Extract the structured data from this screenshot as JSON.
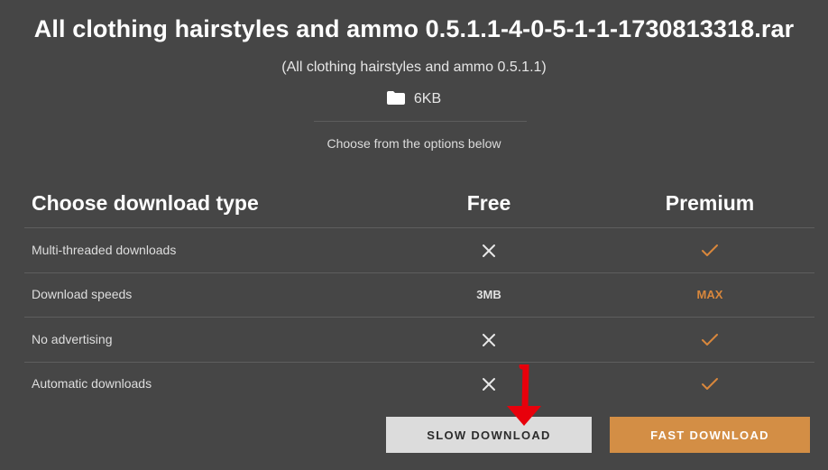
{
  "file": {
    "title": "All clothing hairstyles and ammo 0.5.1.1-4-0-5-1-1-1730813318.rar",
    "subtitle": "(All clothing hairstyles and ammo 0.5.1.1)",
    "size": "6KB",
    "size_icon": "folder-icon"
  },
  "note": "Choose from the options below",
  "table": {
    "headers": {
      "type": "Choose download type",
      "free": "Free",
      "premium": "Premium"
    },
    "rows": [
      {
        "label": "Multi-threaded downloads",
        "free_icon": "cross-icon",
        "premium_icon": "check-icon"
      },
      {
        "label": "Download speeds",
        "free": "3MB",
        "premium": "MAX"
      },
      {
        "label": "No advertising",
        "free_icon": "cross-icon",
        "premium_icon": "check-icon"
      },
      {
        "label": "Automatic downloads",
        "free_icon": "cross-icon",
        "premium_icon": "check-icon"
      }
    ]
  },
  "buttons": {
    "slow": "SLOW DOWNLOAD",
    "fast": "FAST DOWNLOAD"
  },
  "annotation": {
    "arrow_icon": "red-arrow-down-icon"
  },
  "colors": {
    "background": "#464646",
    "accent": "#d38e45",
    "check": "#d8873c",
    "slow_button": "#dcdcdc",
    "arrow": "#e8000b"
  }
}
